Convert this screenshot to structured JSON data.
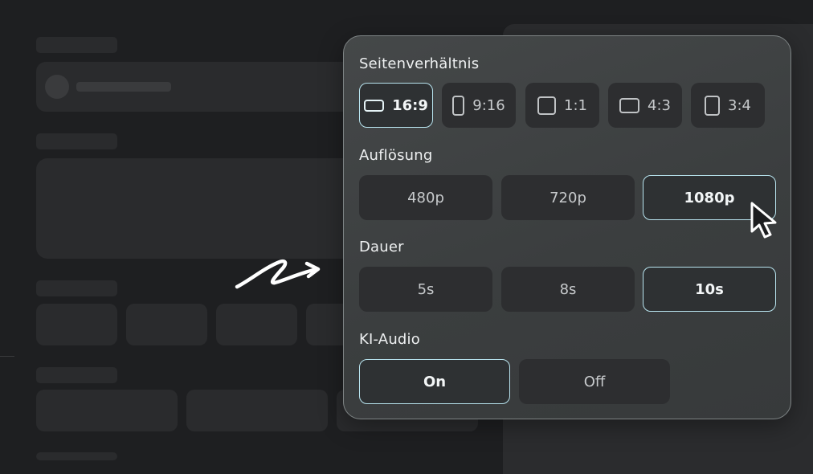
{
  "panel": {
    "aspect_label": "Seitenverhältnis",
    "aspect_options": [
      {
        "label": "16:9",
        "icon": "ratio-16-9-icon",
        "selected": true
      },
      {
        "label": "9:16",
        "icon": "ratio-9-16-icon",
        "selected": false
      },
      {
        "label": "1:1",
        "icon": "ratio-1-1-icon",
        "selected": false
      },
      {
        "label": "4:3",
        "icon": "ratio-4-3-icon",
        "selected": false
      },
      {
        "label": "3:4",
        "icon": "ratio-3-4-icon",
        "selected": false
      }
    ],
    "resolution_label": "Auflösung",
    "resolution_options": [
      {
        "label": "480p",
        "selected": false
      },
      {
        "label": "720p",
        "selected": false
      },
      {
        "label": "1080p",
        "selected": true
      }
    ],
    "duration_label": "Dauer",
    "duration_options": [
      {
        "label": "5s",
        "selected": false
      },
      {
        "label": "8s",
        "selected": false
      },
      {
        "label": "10s",
        "selected": true
      }
    ],
    "audio_label": "KI-Audio",
    "audio_options": [
      {
        "label": "On",
        "selected": true
      },
      {
        "label": "Off",
        "selected": false
      }
    ]
  },
  "colors": {
    "background": "#1e1f21",
    "panel": "#3e4142",
    "option": "#2d2e30",
    "selected_border": "#b8e4ef"
  }
}
